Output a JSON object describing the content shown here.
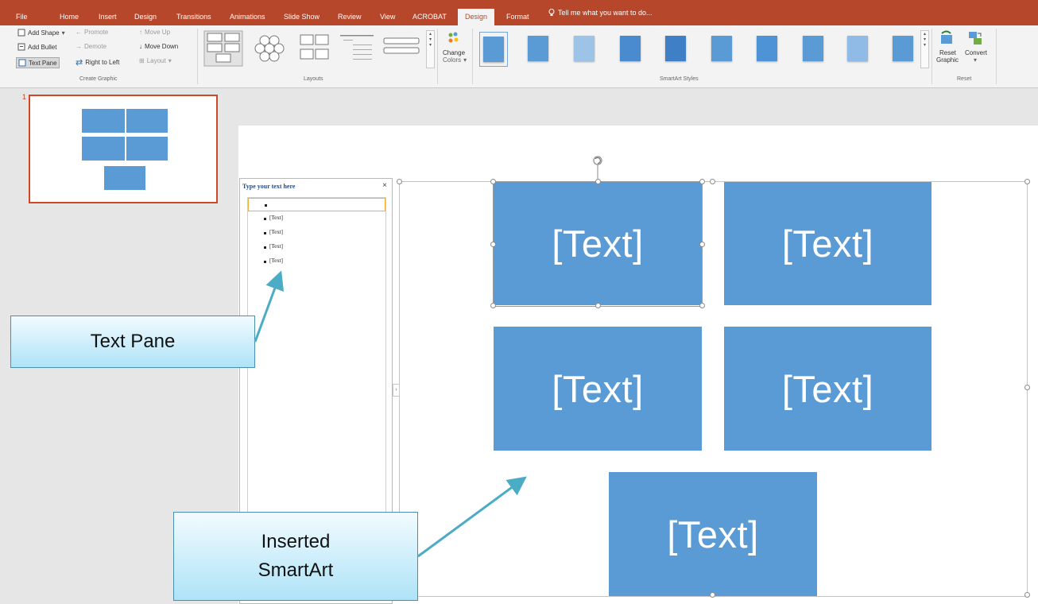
{
  "tabs": [
    "File",
    "Home",
    "Insert",
    "Design",
    "Transitions",
    "Animations",
    "Slide Show",
    "Review",
    "View",
    "ACROBAT",
    "Design",
    "Format"
  ],
  "tell_me": "Tell me what you want to do...",
  "ribbon": {
    "create_graphic": {
      "add_shape": "Add Shape",
      "add_bullet": "Add Bullet",
      "text_pane": "Text Pane",
      "promote": "Promote",
      "demote": "Demote",
      "right_to_left": "Right to Left",
      "move_up": "Move Up",
      "move_down": "Move Down",
      "layout": "Layout",
      "label": "Create Graphic"
    },
    "layouts_label": "Layouts",
    "change_colors_line1": "Change",
    "change_colors_line2": "Colors",
    "styles_label": "SmartArt Styles",
    "reset_graphic_line1": "Reset",
    "reset_graphic_line2": "Graphic",
    "convert": "Convert",
    "reset_label": "Reset"
  },
  "colors": {
    "ribbon_accent": "#b7472a",
    "smartart_fill": "#5b9bd5",
    "slide_selected_border": "#d24726"
  },
  "thumbnail": {
    "slide_number": "1"
  },
  "text_pane": {
    "title": "Type your text here",
    "close": "×",
    "items": [
      "[Text]",
      "[Text]",
      "[Text]",
      "[Text]"
    ]
  },
  "smartart": {
    "boxes": [
      "[Text]",
      "[Text]",
      "[Text]",
      "[Text]",
      "[Text]"
    ]
  },
  "callouts": {
    "text_pane": "Text Pane",
    "smartart_line1": "Inserted",
    "smartart_line2": "SmartArt"
  }
}
